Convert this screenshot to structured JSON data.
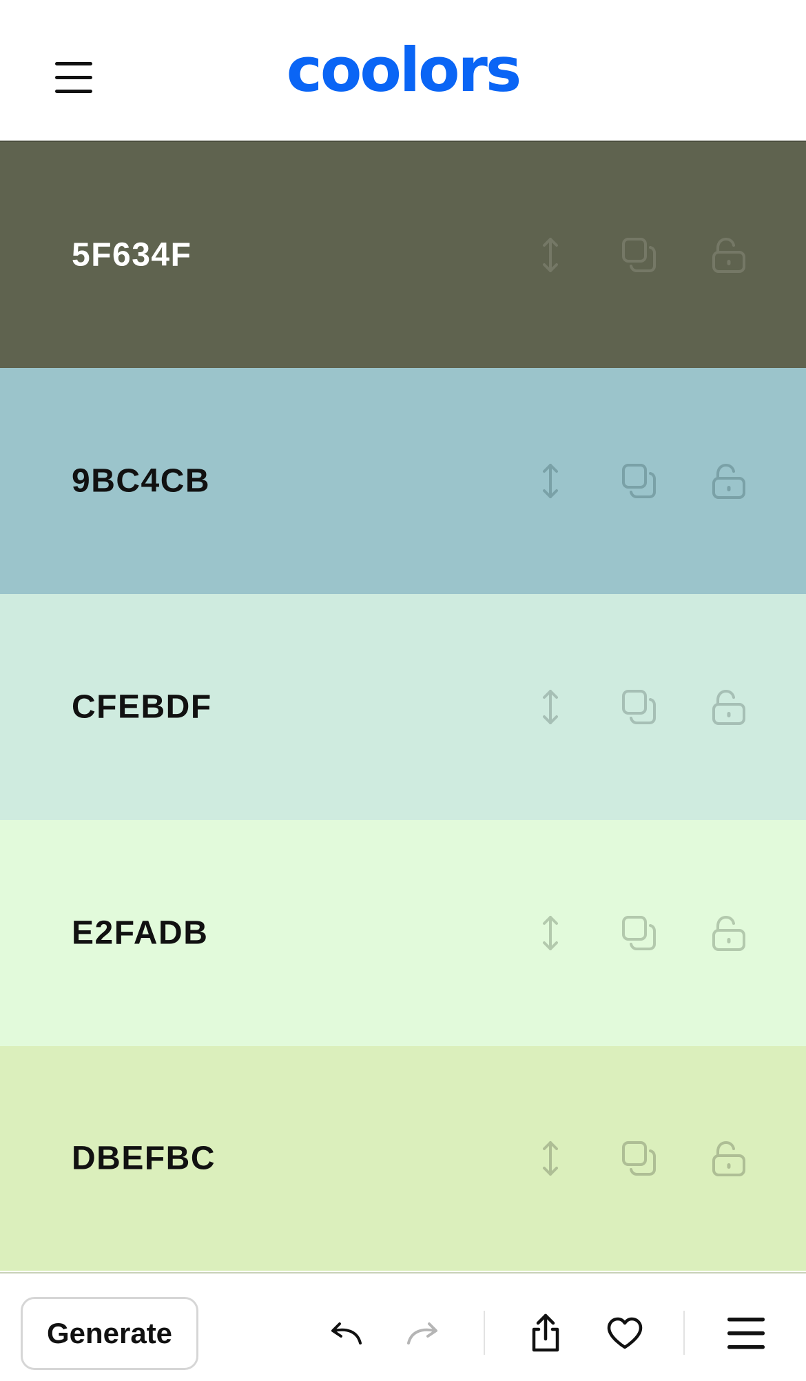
{
  "header": {
    "logo_text": "coolors",
    "logo_color": "#0a65f5"
  },
  "palette": [
    {
      "hex": "5F634F",
      "color": "#5f634f",
      "text_color": "#ffffff",
      "icon_color": "#757866"
    },
    {
      "hex": "9BC4CB",
      "color": "#9bc4cb",
      "text_color": "#111111",
      "icon_color": "#7aa1a7"
    },
    {
      "hex": "CFEBDF",
      "color": "#cfebdf",
      "text_color": "#111111",
      "icon_color": "#a6bfb5"
    },
    {
      "hex": "E2FADB",
      "color": "#e2fadb",
      "text_color": "#111111",
      "icon_color": "#b3c9ad"
    },
    {
      "hex": "DBEFBC",
      "color": "#dbefbc",
      "text_color": "#111111",
      "icon_color": "#aebe95"
    }
  ],
  "swatch_tools": [
    "drag-icon",
    "copy-icon",
    "unlock-icon"
  ],
  "bottom_bar": {
    "generate_label": "Generate",
    "buttons": [
      "undo-icon",
      "redo-icon",
      "share-icon",
      "heart-icon",
      "menu-icon"
    ]
  }
}
